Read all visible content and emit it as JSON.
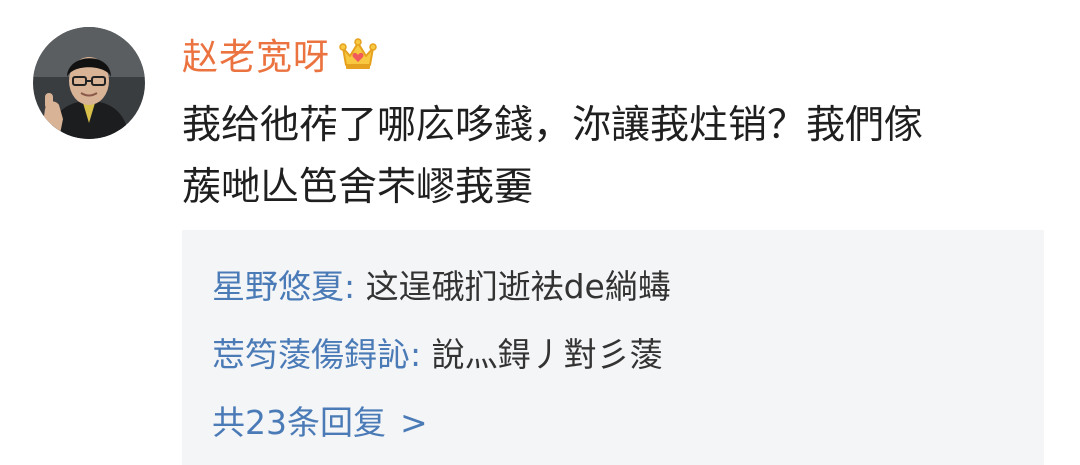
{
  "post": {
    "username": "赵老宽呀",
    "badge_icon": "crown-icon",
    "content_lines": [
      "莪给彵莋了哪庅哆錢，沵讓莪炷销？莪們傢",
      "蔟哋亾笆舍芣嵺莪嫑"
    ]
  },
  "replies": [
    {
      "author": "星野悠夏",
      "separator": ": ",
      "text": "这逞硪扪逝袪de緔蝳"
    },
    {
      "author": "莣笉蔆傷鍀訫",
      "separator": ": ",
      "text": "說灬鍀丿對彡蔆"
    }
  ],
  "more_replies": {
    "label": "共23条回复",
    "chevron": ">"
  },
  "colors": {
    "username": "#eb7340",
    "reply_author": "#4a7bb7",
    "reply_bg": "#f4f5f7",
    "text": "#1f1f1f"
  }
}
